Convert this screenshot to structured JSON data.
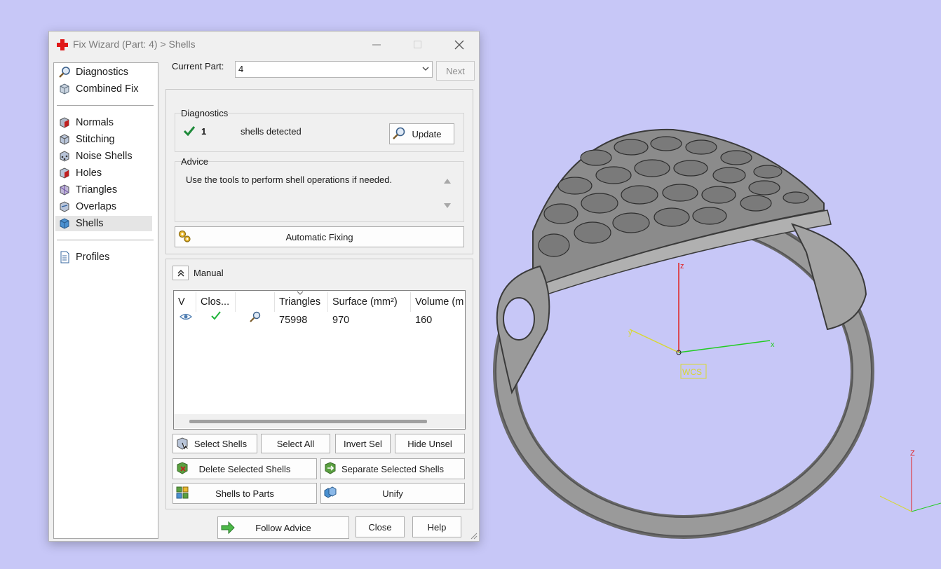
{
  "window": {
    "title": "Fix Wizard (Part: 4) > Shells"
  },
  "sidebar": {
    "items": [
      {
        "label": "Diagnostics",
        "icon": "magnifier-icon"
      },
      {
        "label": "Combined Fix",
        "icon": "cube-icon"
      },
      {
        "label": "Normals",
        "icon": "normals-cube-icon"
      },
      {
        "label": "Stitching",
        "icon": "stitching-cube-icon"
      },
      {
        "label": "Noise Shells",
        "icon": "noise-shells-cube-icon"
      },
      {
        "label": "Holes",
        "icon": "holes-cube-icon"
      },
      {
        "label": "Triangles",
        "icon": "triangles-cube-icon"
      },
      {
        "label": "Overlaps",
        "icon": "overlaps-cube-icon"
      },
      {
        "label": "Shells",
        "icon": "shells-cube-icon",
        "selected": true
      },
      {
        "label": "Profiles",
        "icon": "document-icon"
      }
    ]
  },
  "part": {
    "label": "Current Part:",
    "value": "4",
    "next_label": "Next"
  },
  "diagnostics": {
    "title": "Diagnostics",
    "count": "1",
    "status_text": "shells detected",
    "update_label": "Update"
  },
  "advice": {
    "title": "Advice",
    "text": "Use the tools to perform shell operations if needed."
  },
  "automatic_fixing_label": "Automatic Fixing",
  "manual": {
    "title": "Manual",
    "columns": [
      "V",
      "Clos...",
      "",
      "Triangles",
      "Surface (mm²)",
      "Volume (m"
    ],
    "rows": [
      {
        "triangles": "75998",
        "surface": "970",
        "volume": "160"
      }
    ]
  },
  "tool_buttons": {
    "select_shells": "Select Shells",
    "select_all": "Select All",
    "invert_sel": "Invert Sel",
    "hide_unsel": "Hide Unsel",
    "delete_selected": "Delete Selected Shells",
    "separate_selected": "Separate Selected Shells",
    "shells_to_parts": "Shells to Parts",
    "unify": "Unify"
  },
  "footer": {
    "follow_advice": "Follow Advice",
    "close": "Close",
    "help": "Help"
  },
  "viewport": {
    "axis_z": "z",
    "axis_x": "x",
    "axis_y": "y",
    "wcs_label": "WCS",
    "mini_axis_z": "Z"
  },
  "colors": {
    "viewport_bg": "#c7c7f7",
    "axis_x": "#22cc22",
    "axis_y": "#d8d830",
    "axis_z": "#e02020",
    "accent_check": "#1e8a3a"
  }
}
